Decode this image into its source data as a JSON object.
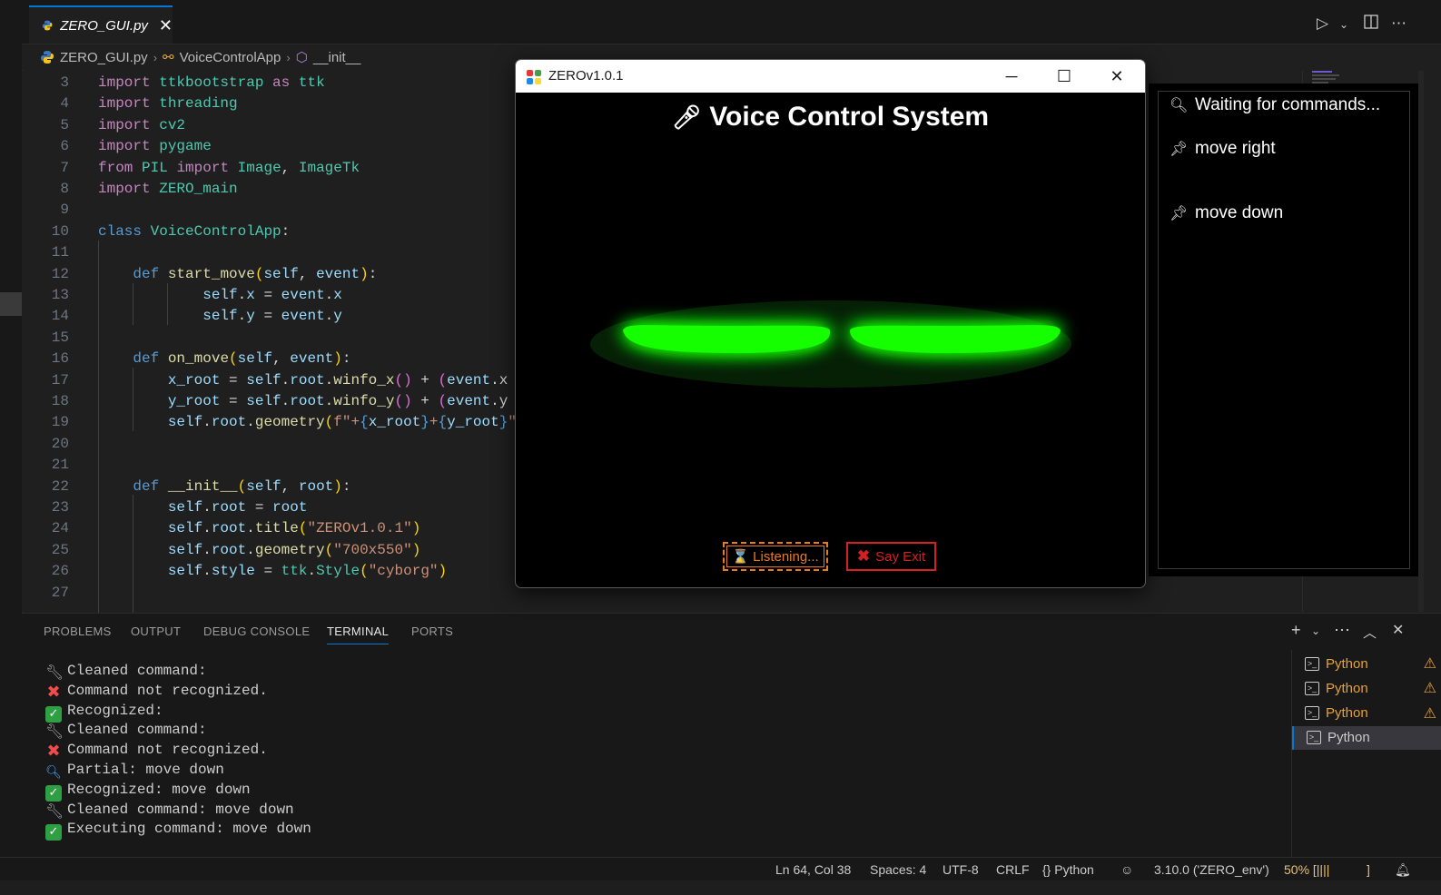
{
  "editor_tab": {
    "filename": "ZERO_GUI.py",
    "close": "✕"
  },
  "breadcrumb": {
    "file": "ZERO_GUI.py",
    "class": "VoiceControlApp",
    "method": "__init__",
    "sep": "›"
  },
  "code_lines": [
    {
      "n": "3",
      "t": [
        [
          "kw",
          "import"
        ],
        [
          "pl",
          " "
        ],
        [
          "md",
          "ttkbootstrap"
        ],
        [
          "pl",
          " "
        ],
        [
          "kw",
          "as"
        ],
        [
          "pl",
          " "
        ],
        [
          "md",
          "ttk"
        ]
      ]
    },
    {
      "n": "4",
      "t": [
        [
          "kw",
          "import"
        ],
        [
          "pl",
          " "
        ],
        [
          "md",
          "threading"
        ]
      ]
    },
    {
      "n": "5",
      "t": [
        [
          "kw",
          "import"
        ],
        [
          "pl",
          " "
        ],
        [
          "md",
          "cv2"
        ]
      ]
    },
    {
      "n": "6",
      "t": [
        [
          "kw",
          "import"
        ],
        [
          "pl",
          " "
        ],
        [
          "md",
          "pygame"
        ]
      ]
    },
    {
      "n": "7",
      "t": [
        [
          "kw",
          "from"
        ],
        [
          "pl",
          " "
        ],
        [
          "md",
          "PIL"
        ],
        [
          "pl",
          " "
        ],
        [
          "kw",
          "import"
        ],
        [
          "pl",
          " "
        ],
        [
          "md",
          "Image"
        ],
        [
          "pl",
          ", "
        ],
        [
          "md",
          "ImageTk"
        ]
      ]
    },
    {
      "n": "8",
      "t": [
        [
          "kw",
          "import"
        ],
        [
          "pl",
          " "
        ],
        [
          "md",
          "ZERO_main"
        ]
      ]
    },
    {
      "n": "9",
      "t": []
    },
    {
      "n": "10",
      "t": [
        [
          "kd",
          "class"
        ],
        [
          "pl",
          " "
        ],
        [
          "md",
          "VoiceControlApp"
        ],
        [
          "pl",
          ":"
        ]
      ]
    },
    {
      "n": "11",
      "t": []
    },
    {
      "n": "12",
      "t": [
        [
          "pl",
          "    "
        ],
        [
          "kd",
          "def"
        ],
        [
          "pl",
          " "
        ],
        [
          "fn",
          "start_move"
        ],
        [
          "br2",
          "("
        ],
        [
          "vr",
          "self"
        ],
        [
          "pl",
          ", "
        ],
        [
          "vr",
          "event"
        ],
        [
          "br2",
          ")"
        ],
        [
          "pl",
          ":"
        ]
      ]
    },
    {
      "n": "13",
      "t": [
        [
          "pl",
          "            "
        ],
        [
          "vr",
          "self"
        ],
        [
          "pl",
          "."
        ],
        [
          "vr",
          "x"
        ],
        [
          "pl",
          " = "
        ],
        [
          "vr",
          "event"
        ],
        [
          "pl",
          "."
        ],
        [
          "vr",
          "x"
        ]
      ]
    },
    {
      "n": "14",
      "t": [
        [
          "pl",
          "            "
        ],
        [
          "vr",
          "self"
        ],
        [
          "pl",
          "."
        ],
        [
          "vr",
          "y"
        ],
        [
          "pl",
          " = "
        ],
        [
          "vr",
          "event"
        ],
        [
          "pl",
          "."
        ],
        [
          "vr",
          "y"
        ]
      ]
    },
    {
      "n": "15",
      "t": []
    },
    {
      "n": "16",
      "t": [
        [
          "pl",
          "    "
        ],
        [
          "kd",
          "def"
        ],
        [
          "pl",
          " "
        ],
        [
          "fn",
          "on_move"
        ],
        [
          "br2",
          "("
        ],
        [
          "vr",
          "self"
        ],
        [
          "pl",
          ", "
        ],
        [
          "vr",
          "event"
        ],
        [
          "br2",
          ")"
        ],
        [
          "pl",
          ":"
        ]
      ]
    },
    {
      "n": "17",
      "t": [
        [
          "pl",
          "        "
        ],
        [
          "vr",
          "x_root"
        ],
        [
          "pl",
          " = "
        ],
        [
          "vr",
          "self"
        ],
        [
          "pl",
          "."
        ],
        [
          "vr",
          "root"
        ],
        [
          "pl",
          "."
        ],
        [
          "fn",
          "winfo_x"
        ],
        [
          "br",
          "()"
        ],
        [
          "pl",
          " + "
        ],
        [
          "br",
          "("
        ],
        [
          "vr",
          "event"
        ],
        [
          "pl",
          ".x -"
        ]
      ]
    },
    {
      "n": "18",
      "t": [
        [
          "pl",
          "        "
        ],
        [
          "vr",
          "y_root"
        ],
        [
          "pl",
          " = "
        ],
        [
          "vr",
          "self"
        ],
        [
          "pl",
          "."
        ],
        [
          "vr",
          "root"
        ],
        [
          "pl",
          "."
        ],
        [
          "fn",
          "winfo_y"
        ],
        [
          "br",
          "()"
        ],
        [
          "pl",
          " + "
        ],
        [
          "br",
          "("
        ],
        [
          "vr",
          "event"
        ],
        [
          "pl",
          ".y -"
        ]
      ]
    },
    {
      "n": "19",
      "t": [
        [
          "pl",
          "        "
        ],
        [
          "vr",
          "self"
        ],
        [
          "pl",
          "."
        ],
        [
          "vr",
          "root"
        ],
        [
          "pl",
          "."
        ],
        [
          "fn",
          "geometry"
        ],
        [
          "br2",
          "("
        ],
        [
          "st",
          "f\"+"
        ],
        [
          "kd",
          "{"
        ],
        [
          "vr",
          "x_root"
        ],
        [
          "kd",
          "}"
        ],
        [
          "st",
          "+"
        ],
        [
          "kd",
          "{"
        ],
        [
          "vr",
          "y_root"
        ],
        [
          "kd",
          "}"
        ],
        [
          "st",
          "\""
        ],
        [
          "br2",
          ")"
        ]
      ]
    },
    {
      "n": "20",
      "t": []
    },
    {
      "n": "21",
      "t": []
    },
    {
      "n": "22",
      "t": [
        [
          "pl",
          "    "
        ],
        [
          "kd",
          "def"
        ],
        [
          "pl",
          " "
        ],
        [
          "fn",
          "__init__"
        ],
        [
          "br2",
          "("
        ],
        [
          "vr",
          "self"
        ],
        [
          "pl",
          ", "
        ],
        [
          "vr",
          "root"
        ],
        [
          "br2",
          ")"
        ],
        [
          "pl",
          ":"
        ]
      ]
    },
    {
      "n": "23",
      "t": [
        [
          "pl",
          "        "
        ],
        [
          "vr",
          "self"
        ],
        [
          "pl",
          "."
        ],
        [
          "vr",
          "root"
        ],
        [
          "pl",
          " = "
        ],
        [
          "vr",
          "root"
        ]
      ]
    },
    {
      "n": "24",
      "t": [
        [
          "pl",
          "        "
        ],
        [
          "vr",
          "self"
        ],
        [
          "pl",
          "."
        ],
        [
          "vr",
          "root"
        ],
        [
          "pl",
          "."
        ],
        [
          "fn",
          "title"
        ],
        [
          "br2",
          "("
        ],
        [
          "st",
          "\"ZEROv1.0.1\""
        ],
        [
          "br2",
          ")"
        ]
      ]
    },
    {
      "n": "25",
      "t": [
        [
          "pl",
          "        "
        ],
        [
          "vr",
          "self"
        ],
        [
          "pl",
          "."
        ],
        [
          "vr",
          "root"
        ],
        [
          "pl",
          "."
        ],
        [
          "fn",
          "geometry"
        ],
        [
          "br2",
          "("
        ],
        [
          "st",
          "\"700x550\""
        ],
        [
          "br2",
          ")"
        ]
      ]
    },
    {
      "n": "26",
      "t": [
        [
          "pl",
          "        "
        ],
        [
          "vr",
          "self"
        ],
        [
          "pl",
          "."
        ],
        [
          "vr",
          "style"
        ],
        [
          "pl",
          " = "
        ],
        [
          "md",
          "ttk"
        ],
        [
          "pl",
          "."
        ],
        [
          "md",
          "Style"
        ],
        [
          "br2",
          "("
        ],
        [
          "st",
          "\"cyborg\""
        ],
        [
          "br2",
          ")"
        ]
      ]
    },
    {
      "n": "27",
      "t": []
    }
  ],
  "panel": {
    "tabs": [
      "PROBLEMS",
      "OUTPUT",
      "DEBUG CONSOLE",
      "TERMINAL",
      "PORTS"
    ],
    "active_tab": "TERMINAL",
    "terminal_lines": [
      {
        "icon": "wrench",
        "text": "Cleaned command:"
      },
      {
        "icon": "cross",
        "text": "Command not recognized."
      },
      {
        "icon": "check",
        "text": "Recognized:"
      },
      {
        "icon": "wrench",
        "text": "Cleaned command:"
      },
      {
        "icon": "cross",
        "text": "Command not recognized."
      },
      {
        "icon": "magnifier",
        "text": "Partial: move down"
      },
      {
        "icon": "check",
        "text": "Recognized: move down"
      },
      {
        "icon": "wrench",
        "text": "Cleaned command: move down"
      },
      {
        "icon": "check",
        "text": "Executing command: move down"
      }
    ],
    "terminals": [
      {
        "label": "Python",
        "warning": true
      },
      {
        "label": "Python",
        "warning": true
      },
      {
        "label": "Python",
        "warning": true
      },
      {
        "label": "Python",
        "warning": false
      }
    ]
  },
  "statusbar": {
    "position": "Ln 64, Col 38",
    "spaces": "Spaces: 4",
    "encoding": "UTF-8",
    "eol": "CRLF",
    "language": "{} Python",
    "interpreter": "3.10.0 ('ZERO_env')",
    "zoom": "50% [||||",
    "bracket": "]"
  },
  "app_window": {
    "title": "ZEROv1.0.1",
    "heading": "Voice Control System",
    "listen_button": "⌛ Listening...",
    "exit_button": "Say Exit",
    "eye_color": "#19ff00"
  },
  "side_panel": {
    "status": "Waiting for commands...",
    "commands": [
      "move right",
      "move down"
    ]
  },
  "colors": {
    "accent": "#0078d4",
    "warning": "#e5a03b",
    "listen": "#e87b1e",
    "exit": "#d42020"
  }
}
